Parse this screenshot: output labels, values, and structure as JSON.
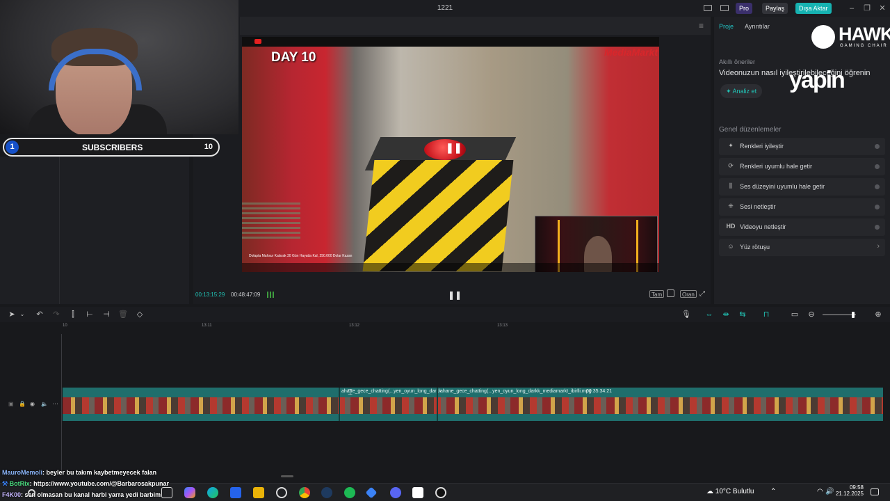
{
  "titlebar": {
    "title": "1221",
    "pro_label": "Pro",
    "share_label": "Paylaş",
    "export_label": "Dışa Aktar"
  },
  "overlay": {
    "subscribers_label": "SUBSCRIBERS",
    "left_count": "1",
    "right_count": "10"
  },
  "video": {
    "day_label": "DAY 10",
    "brand": "MediaMarkt",
    "caption": "Dolapta Mahsur Kalarak 30 Gün Hayatta Kal, 250.000 Dolar Kazan"
  },
  "player": {
    "current_time": "00:13:15:29",
    "total_time": "00:48:47:09",
    "btn_full": "Tam",
    "btn_ratio": "Oran"
  },
  "right_panel": {
    "tabs": [
      "Proje",
      "Ayrıntılar"
    ],
    "sponsor_title": "HAWK",
    "sponsor_sub": "GAMING CHAIR",
    "smart_heading": "Akıllı öneriler",
    "smart_text": "Videonuzun nasıl iyileştirilebileceğini öğrenin",
    "yapin_logo": "yapin",
    "analyze_label": "Analiz et",
    "general_heading": "Genel düzenlemeler",
    "options": [
      {
        "icon": "✦",
        "label": "Renkleri iyileştir"
      },
      {
        "icon": "⟳",
        "label": "Renkleri uyumlu hale getir"
      },
      {
        "icon": "⫼",
        "label": "Ses düzeyini uyumlu hale getir"
      },
      {
        "icon": "⁜",
        "label": "Sesi netleştir"
      },
      {
        "icon": "HD",
        "label": "Videoyu netleştir"
      },
      {
        "icon": "☺",
        "label": "Yüz rötuşu"
      }
    ]
  },
  "timeline": {
    "ticks": [
      "10",
      "13:11",
      "13:12",
      "13:13"
    ],
    "clip_name_1": "ahane_gece_chatting(...yen_oyun_long_darkk",
    "clip_name_2": "ahane_gece_chatting(...yen_oyun_long_darkk_mediamarkt_ibirlli.mpg",
    "clip_duration": "00:35:34:21"
  },
  "chat": [
    {
      "user": "MauroMemoli",
      "text": ": beyler bu takım kaybetmeyecek falan"
    },
    {
      "user": "BotRix",
      "text": ": https://www.youtube.com/@Barbarosakpunar"
    },
    {
      "user": "F4K00",
      "text": ": sen olmasan bu kanal harbi yarra yedi barbim"
    }
  ],
  "taskbar": {
    "weather": "10°C  Bulutlu",
    "time": "09:58",
    "date": "21.12.2025"
  }
}
